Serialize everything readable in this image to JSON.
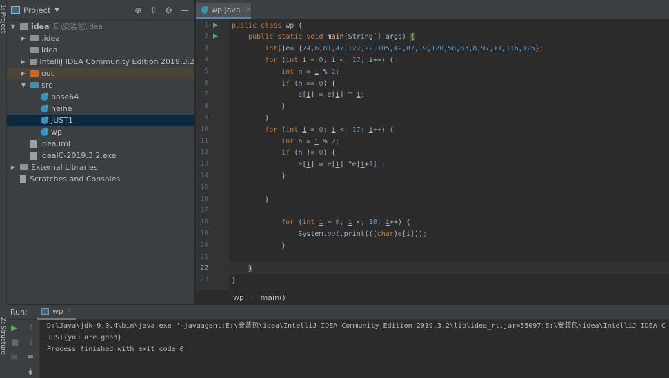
{
  "left_strip": {
    "project_tab": "1: Project",
    "structure_tab": "Z: Structure"
  },
  "project_panel": {
    "title": "Project",
    "tree": [
      {
        "label": "idea",
        "hint": "E:\\安装包\\idea",
        "indent": 0,
        "arrow": "down",
        "icon": "module-folder",
        "bold": true
      },
      {
        "label": ".idea",
        "indent": 1,
        "arrow": "right",
        "icon": "folder"
      },
      {
        "label": "idea",
        "indent": 1,
        "arrow": "",
        "icon": "folder"
      },
      {
        "label": "IntelliJ IDEA Community Edition 2019.3.2",
        "indent": 1,
        "arrow": "right",
        "icon": "folder"
      },
      {
        "label": "out",
        "indent": 1,
        "arrow": "right",
        "icon": "folder-orange",
        "state": "out"
      },
      {
        "label": "src",
        "indent": 1,
        "arrow": "down",
        "icon": "folder-blue"
      },
      {
        "label": "base64",
        "indent": 2,
        "arrow": "",
        "icon": "class"
      },
      {
        "label": "heihe",
        "indent": 2,
        "arrow": "",
        "icon": "class"
      },
      {
        "label": "JUST1",
        "indent": 2,
        "arrow": "",
        "icon": "class",
        "state": "sel"
      },
      {
        "label": "wp",
        "indent": 2,
        "arrow": "",
        "icon": "class"
      },
      {
        "label": "idea.iml",
        "indent": 1,
        "arrow": "",
        "icon": "file"
      },
      {
        "label": "ideaIC-2019.3.2.exe",
        "indent": 1,
        "arrow": "",
        "icon": "file"
      },
      {
        "label": "External Libraries",
        "indent": 0,
        "arrow": "right",
        "icon": "library"
      },
      {
        "label": "Scratches and Consoles",
        "indent": 0,
        "arrow": "",
        "icon": "scratch"
      }
    ]
  },
  "editor": {
    "tab_label": "wp.java",
    "current_line": 22,
    "run_gutter_lines": [
      1,
      2
    ],
    "lines": [
      "public class wp {",
      "    public static void main(String[] args) {",
      "        int[]e= {74,6,81,47,127,22,105,42,87,19,120,58,83,8,97,11,116,125};",
      "        for (int i = 0; i < 17; i++) {",
      "            int n = i % 2;",
      "            if (n == 0) {",
      "                e[i] = e[i] ^ i;",
      "            }",
      "        }",
      "        for (int i = 0; i < 17; i++) {",
      "            int n = i % 2;",
      "            if (n != 0) {",
      "                e[i] = e[i] ^e[i+1] ;",
      "            }",
      "",
      "        }",
      "",
      "            for (int i = 0; i < 18; i++) {",
      "                System.out.print(((char)e[i]));",
      "            }",
      "",
      "    }",
      "}"
    ],
    "breadcrumb": [
      "wp",
      "main()"
    ]
  },
  "run_panel": {
    "label": "Run:",
    "tab": "wp",
    "output": [
      "D:\\Java\\jdk-9.0.4\\bin\\java.exe \"-javaagent:E:\\安装包\\idea\\IntelliJ IDEA Community Edition 2019.3.2\\lib\\idea_rt.jar=55097:E:\\安装包\\idea\\IntelliJ IDEA C",
      "JUST{you_are_good}",
      "Process finished with exit code 0"
    ]
  }
}
